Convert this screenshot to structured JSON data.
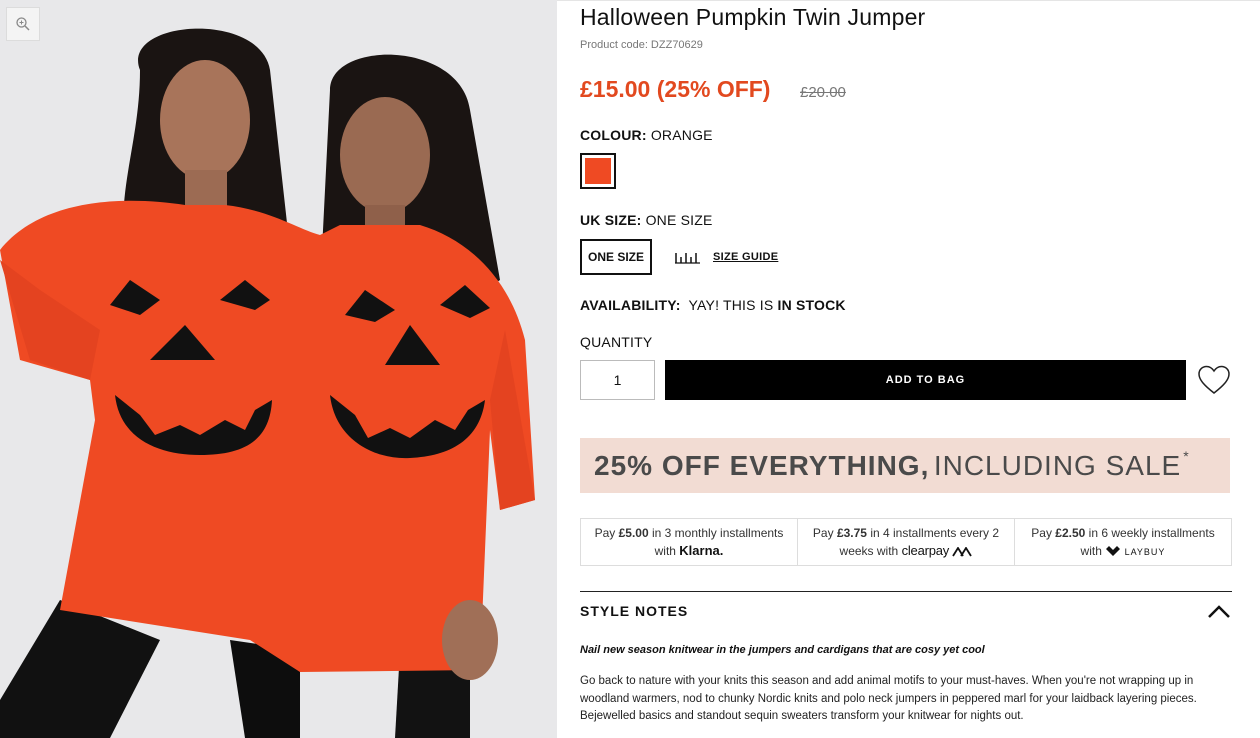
{
  "product": {
    "title": "Halloween Pumpkin Twin Jumper",
    "code": "Product code: DZZ70629",
    "price": "£15.00 (25% OFF)",
    "was_price": "£20.00"
  },
  "colour": {
    "label": "COLOUR:",
    "value": "ORANGE",
    "swatch_color": "#ef4a23"
  },
  "size": {
    "label": "UK SIZE:",
    "value": "ONE SIZE",
    "option": "ONE SIZE",
    "guide_label": "SIZE GUIDE"
  },
  "availability": {
    "label": "AVAILABILITY:",
    "prefix": "YAY! THIS IS",
    "status": "IN STOCK"
  },
  "quantity": {
    "label": "QUANTITY",
    "value": "1"
  },
  "cart": {
    "add_label": "ADD TO BAG"
  },
  "promo": {
    "bold": "25% OFF EVERYTHING,",
    "light": "INCLUDING SALE",
    "star": "*"
  },
  "payments": [
    {
      "pre": "Pay",
      "amount": "£5.00",
      "mid": "in 3 monthly installments with",
      "provider": "Klarna."
    },
    {
      "pre": "Pay",
      "amount": "£3.75",
      "mid": "in 4 installments every 2 weeks with",
      "provider": "clearpay"
    },
    {
      "pre": "Pay",
      "amount": "£2.50",
      "mid": "in 6 weekly installments with",
      "provider": "LAYBUY"
    }
  ],
  "style_notes": {
    "heading": "STYLE NOTES",
    "tagline": "Nail new season knitwear in the jumpers and cardigans that are cosy yet cool",
    "body": "Go back to nature with your knits this season and add animal motifs to your must-haves. When you're not wrapping up in woodland warmers, nod to chunky Nordic knits and polo neck jumpers in peppered marl for your laidback layering pieces. Bejewelled basics and standout sequin sweaters transform your knitwear for nights out."
  },
  "colors": {
    "accent": "#e2491f",
    "jumper": "#ef4a23",
    "promo_bg": "#f2dcd3"
  }
}
